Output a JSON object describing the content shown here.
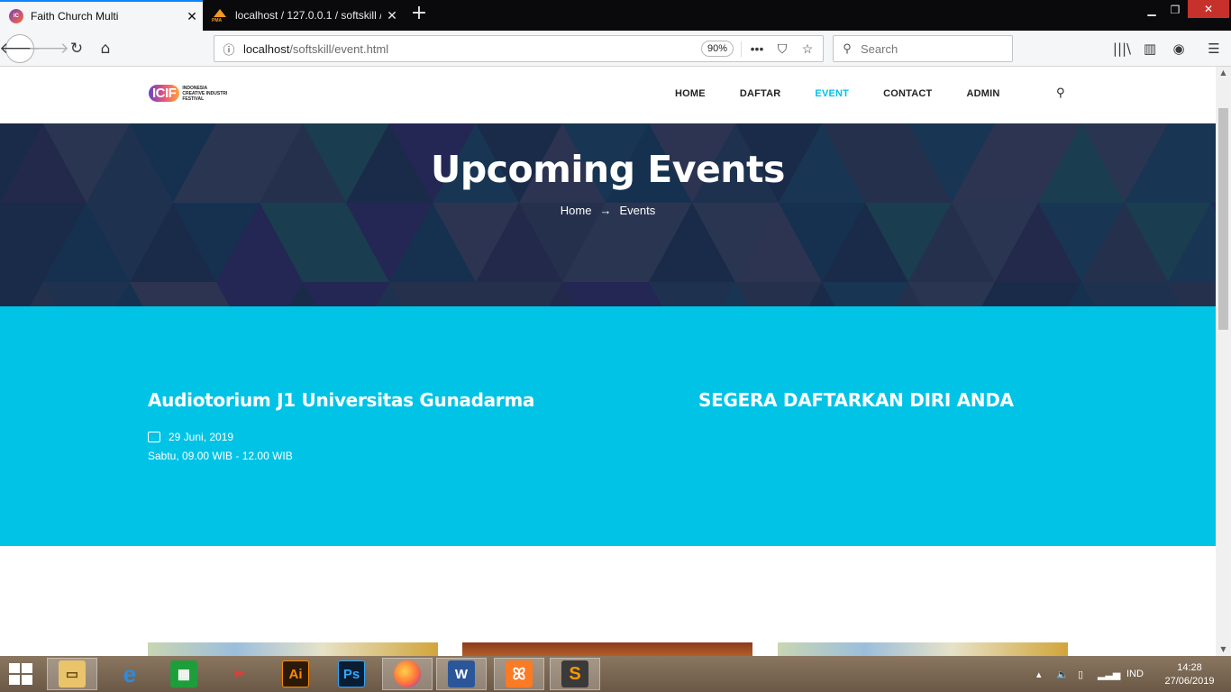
{
  "browser": {
    "tabs": [
      {
        "title": "Faith Church Multi",
        "active": true
      },
      {
        "title": "localhost / 127.0.0.1 / softskill /",
        "active": false
      }
    ],
    "url_host": "localhost",
    "url_path": "/softskill/event.html",
    "zoom": "90%",
    "search_placeholder": "Search"
  },
  "site": {
    "logo_mark": "ICIF",
    "logo_text": "INDONESIA CREATIVE INDUSTRI FESTIVAL",
    "menu": [
      "HOME",
      "DAFTAR",
      "EVENT",
      "CONTACT",
      "ADMIN"
    ],
    "active_menu": "EVENT"
  },
  "banner": {
    "title": "Upcoming Events",
    "breadcrumb_home": "Home",
    "breadcrumb_current": "Events"
  },
  "event": {
    "venue": "Audiotorium J1 Universitas Gunadarma",
    "date": "29 Juni, 2019",
    "time": "Sabtu, 09.00 WIB - 12.00 WIB",
    "cta": "SEGERA DAFTARKAN DIRI ANDA"
  },
  "taskbar": {
    "language": "IND",
    "time": "14:28",
    "date": "27/06/2019"
  },
  "colors": {
    "accent": "#00c3e6",
    "banner_dark": "#1d3050",
    "close_red": "#c7312b"
  }
}
